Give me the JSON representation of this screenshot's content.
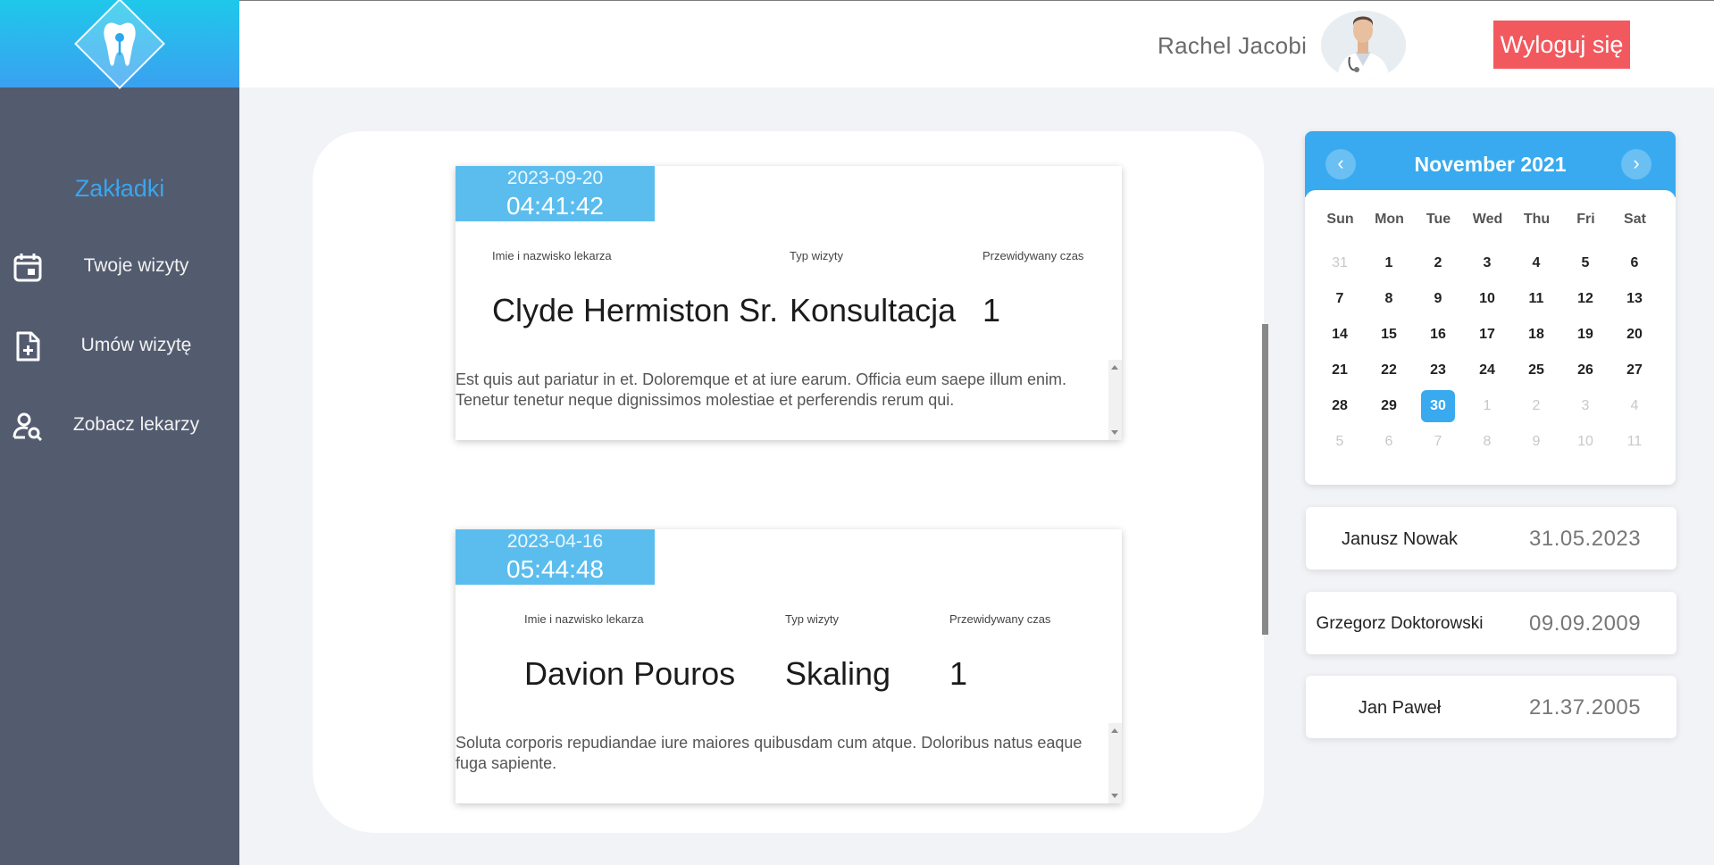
{
  "header": {
    "user_name": "Rachel Jacobi",
    "logout_label": "Wyloguj się"
  },
  "sidebar": {
    "title": "Zakładki",
    "items": [
      {
        "label": "Twoje wizyty",
        "icon": "calendar-icon"
      },
      {
        "label": "Umów wizytę",
        "icon": "file-add-icon"
      },
      {
        "label": "Zobacz lekarzy",
        "icon": "user-search-icon"
      }
    ]
  },
  "visits": [
    {
      "date": "2023-09-20",
      "time": "04:41:42",
      "doctor_label": "Imie i nazwisko lekarza",
      "type_label": "Typ wizyty",
      "duration_label": "Przewidywany czas",
      "doctor": "Clyde Hermiston Sr.",
      "type": "Konsultacja",
      "duration": "1",
      "description": "Est quis aut pariatur in et. Doloremque et at iure earum. Officia eum saepe illum enim. Tenetur tenetur neque dignissimos molestiae et perferendis rerum qui."
    },
    {
      "date": "2023-04-16",
      "time": "05:44:48",
      "doctor_label": "Imie i nazwisko lekarza",
      "type_label": "Typ wizyty",
      "duration_label": "Przewidywany czas",
      "doctor": "Davion Pouros",
      "type": "Skaling",
      "duration": "1",
      "description": "Soluta corporis repudiandae iure maiores quibusdam cum atque. Doloribus natus eaque fuga sapiente."
    }
  ],
  "calendar": {
    "title": "November 2021",
    "prev_icon": "chevron-left-icon",
    "next_icon": "chevron-right-icon",
    "weekdays": [
      "Sun",
      "Mon",
      "Tue",
      "Wed",
      "Thu",
      "Fri",
      "Sat"
    ],
    "weeks": [
      [
        "31",
        "1",
        "2",
        "3",
        "4",
        "5",
        "6"
      ],
      [
        "7",
        "8",
        "9",
        "10",
        "11",
        "12",
        "13"
      ],
      [
        "14",
        "15",
        "16",
        "17",
        "18",
        "19",
        "20"
      ],
      [
        "21",
        "22",
        "23",
        "24",
        "25",
        "26",
        "27"
      ],
      [
        "28",
        "29",
        "30",
        "1",
        "2",
        "3",
        "4"
      ],
      [
        "5",
        "6",
        "7",
        "8",
        "9",
        "10",
        "11"
      ]
    ],
    "selected_day": "30",
    "accent_color": "#39aaef"
  },
  "doctors": [
    {
      "name": "Janusz Nowak",
      "date": "31.05.2023"
    },
    {
      "name": "Grzegorz Doktorowski",
      "date": "09.09.2009"
    },
    {
      "name": "Jan Paweł",
      "date": "21.37.2005"
    }
  ],
  "colors": {
    "sidebar_bg": "#535b6f",
    "accent_blue": "#39aaef",
    "logout_red": "#f2595e",
    "visit_date_bg": "#5bbdee"
  }
}
